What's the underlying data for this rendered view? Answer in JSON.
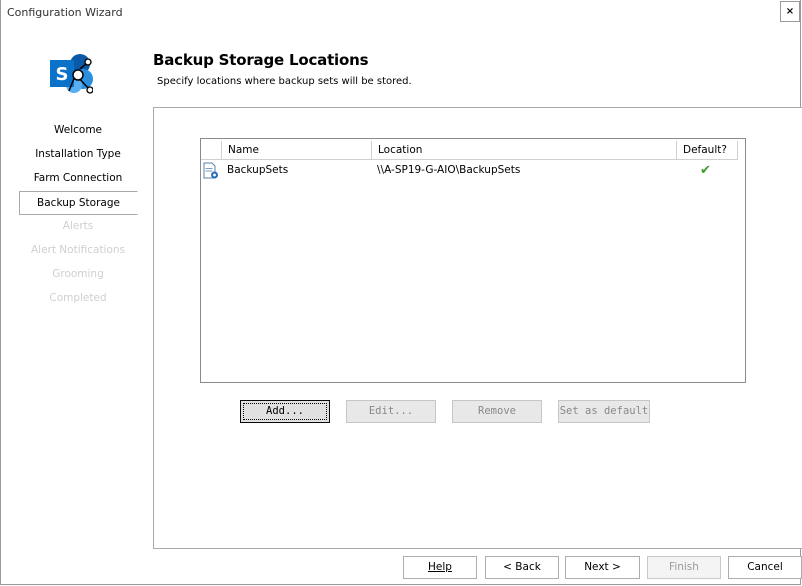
{
  "window": {
    "title": "Configuration Wizard",
    "close_label": "×"
  },
  "header": {
    "heading": "Backup Storage Locations",
    "subheading": "Specify locations where backup sets will be stored."
  },
  "steps": [
    {
      "label": "Welcome",
      "state": "done"
    },
    {
      "label": "Installation Type",
      "state": "done"
    },
    {
      "label": "Farm Connection",
      "state": "done"
    },
    {
      "label": "Backup Storage",
      "state": "active"
    },
    {
      "label": "Alerts",
      "state": "disabled"
    },
    {
      "label": "Alert Notifications",
      "state": "disabled"
    },
    {
      "label": "Grooming",
      "state": "disabled"
    },
    {
      "label": "Completed",
      "state": "disabled"
    }
  ],
  "list": {
    "columns": [
      "Name",
      "Location",
      "Default?"
    ],
    "rows": [
      {
        "name": "BackupSets",
        "location": "\\\\A-SP19-G-AIO\\BackupSets",
        "default_mark": "✔"
      }
    ]
  },
  "actions": {
    "add": "Add...",
    "edit": "Edit...",
    "remove": "Remove",
    "set_default": "Set as default"
  },
  "nav": {
    "help": "Help",
    "back": "< Back",
    "next": "Next >",
    "finish": "Finish",
    "cancel": "Cancel"
  },
  "colors": {
    "check_green": "#3a9a2a",
    "logo_blue": "#0a72c9"
  },
  "icons": [
    "sharepoint-logo-icon",
    "backup-set-icon",
    "checkmark-icon",
    "close-icon"
  ]
}
